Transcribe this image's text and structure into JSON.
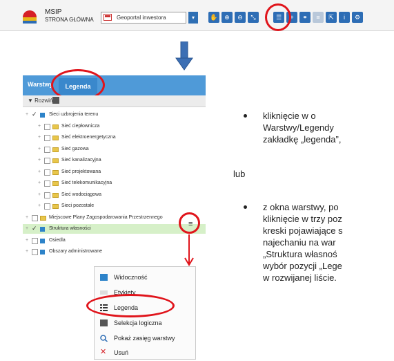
{
  "toolbar": {
    "app_name": "MSIP",
    "home_label": "STRONA GŁÓWNA",
    "portal_select": "Geoportal inwestora",
    "tools": [
      "hand-icon",
      "zoom-in-icon",
      "zoom-out-icon",
      "extent-icon",
      "layers-icon",
      "add-layer-icon",
      "share-icon",
      "list-icon",
      "select-icon",
      "info-icon",
      "settings-icon"
    ]
  },
  "layers_panel": {
    "tab_layers": "Warstwy",
    "tab_legend": "Legenda",
    "expand_button": "Rozwiń",
    "rows": [
      {
        "label": "Sieci uzbrojenia terenu",
        "checked": true,
        "icon": "blue"
      },
      {
        "label": "Sieć ciepłownicza",
        "checked": false,
        "icon": "folder"
      },
      {
        "label": "Sieć elektroenergetyczna",
        "checked": false,
        "icon": "folder"
      },
      {
        "label": "Sieć gazowa",
        "checked": false,
        "icon": "folder"
      },
      {
        "label": "Sieć kanalizacyjna",
        "checked": false,
        "icon": "folder"
      },
      {
        "label": "Sieć projektowana",
        "checked": false,
        "icon": "folder"
      },
      {
        "label": "Sieć telekomunikacyjna",
        "checked": false,
        "icon": "folder"
      },
      {
        "label": "Sieć wodociągowa",
        "checked": false,
        "icon": "folder"
      },
      {
        "label": "Sieci pozostałe",
        "checked": false,
        "icon": "folder"
      },
      {
        "label": "Miejscowe Plany Zagospodarowania Przestrzennego",
        "checked": false,
        "icon": "folder"
      },
      {
        "label": "Struktura własności",
        "checked": true,
        "icon": "blue",
        "selected": true
      },
      {
        "label": "Osiedla",
        "checked": false,
        "icon": "blue"
      },
      {
        "label": "Obszary administrowane",
        "checked": false,
        "icon": "blue"
      }
    ]
  },
  "context_menu": {
    "items": [
      {
        "label": "Widoczność",
        "icon": "visibility-icon"
      },
      {
        "label": "Etykiety",
        "icon": "labels-icon"
      },
      {
        "label": "Legenda",
        "icon": "legend-icon"
      },
      {
        "label": "Selekcja logiczna",
        "icon": "logical-selection-icon"
      },
      {
        "label": "Pokaż zasięg warstwy",
        "icon": "zoom-extent-icon"
      },
      {
        "label": "Usuń",
        "icon": "delete-icon"
      }
    ]
  },
  "instructions": {
    "bullet1_lines": [
      "kliknięcie      w      o",
      "Warstwy/Legendy",
      "zakładkę „legenda”,"
    ],
    "or_word": "lub",
    "bullet2_lines": [
      "z okna warstwy, po",
      "kliknięcie w trzy poz",
      "kreski pojawiające s",
      "najechaniu na war",
      "„Struktura  własnoś",
      "wybór pozycji „Lege",
      "w rozwijanej liście."
    ]
  },
  "colors": {
    "accent_blue": "#2d6db5",
    "highlight_red": "#e0141b",
    "tab_blue": "#4f9ad8"
  }
}
